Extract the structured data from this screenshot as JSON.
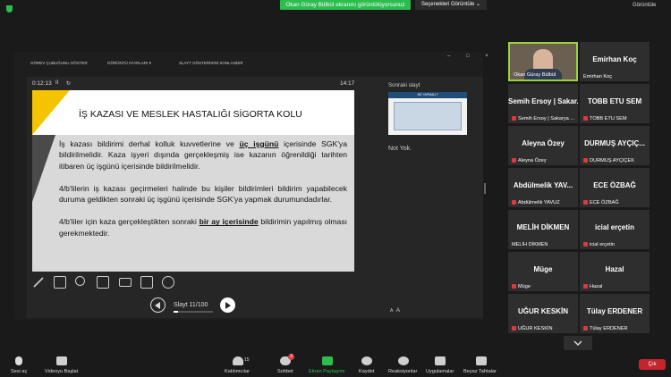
{
  "top": {
    "share_banner": "Okan Güray Bülbül ekranını görüntülüyorsunuz",
    "view_options": "Seçenekleri Görüntüle ⌄",
    "gallery_view": "Görüntüle"
  },
  "ppt_toolbar": {
    "taskbar": "GÖREV ÇUBUĞUNU GÖSTER",
    "display_settings": "GÖRÜNTÜ AYARLARI ▾",
    "end_show": "SLAYT GÖSTERİSİNİ SONLANDIR",
    "window_controls": "– □ ×"
  },
  "presenter": {
    "timer": "0:12:13",
    "pause": "II",
    "redo": "↻",
    "clock": "14:17",
    "next_slide_label": "Sonraki slayt",
    "next_thumb_title": "NE YAPMALI?",
    "notes": "Not Yok.",
    "zoom_small": "A",
    "zoom_big": "A",
    "slide_counter": "Slayt 11/100",
    "progress": 0.11
  },
  "slide": {
    "title": "İŞ KAZASI VE MESLEK HASTALIĞI SİGORTA KOLU",
    "p1_a": "İş kazası bildirimi derhal kolluk kuvvetlerine ve ",
    "p1_u": "üç işgünü",
    "p1_b": " içerisinde SGK'ya bildirilmelidir. Kaza işyeri dışında gerçekleşmiş ise kazanın öğrenildiği tarihten itibaren üç işgünü içerisinde bildirilmelidir.",
    "p2": "4/b'lilerin iş kazası geçirmeleri halinde bu kişiler bildirimleri bildirim yapabilecek duruma geldikten sonraki üç işgünü içerisinde SGK'ya yapmak durumundadırlar.",
    "p3_a": "4/b'liler için kaza gerçekleştikten sonraki ",
    "p3_u": "bir ay içerisinde",
    "p3_b": " bildirimin yapılmış olması gerekmektedir."
  },
  "participants": [
    {
      "name": "",
      "label": "Okan Güray Bülbül",
      "muted": false
    },
    {
      "name": "Emirhan Koç",
      "label": "Emirhan Koç",
      "muted": false
    },
    {
      "name": "Semih Ersoy | Sakar...",
      "label": "Semih Ersoy | Sakarya ...",
      "muted": true
    },
    {
      "name": "TOBB ETU SEM",
      "label": "TOBB ETU SEM",
      "muted": true
    },
    {
      "name": "Aleyna Özey",
      "label": "Aleyna Özey",
      "muted": true
    },
    {
      "name": "DURMUŞ AYÇIÇ...",
      "label": "DURMUŞ AYÇIÇEK",
      "muted": true
    },
    {
      "name": "Abdülmelik YAV...",
      "label": "Abdülmelik YAVUZ",
      "muted": true
    },
    {
      "name": "ECE ÖZBAĞ",
      "label": "ECE ÖZBAĞ",
      "muted": true
    },
    {
      "name": "MELİH DİKMEN",
      "label": "MELİH DİKMEN",
      "muted": false
    },
    {
      "name": "icial erçetin",
      "label": "icial erçetin",
      "muted": true
    },
    {
      "name": "Müge",
      "label": "Müge",
      "muted": true
    },
    {
      "name": "Hazal",
      "label": "Hazal",
      "muted": true
    },
    {
      "name": "UĞUR KESKİN",
      "label": "UĞUR KESKİN",
      "muted": true
    },
    {
      "name": "Tülay ERDENER",
      "label": "Tülay ERDENER",
      "muted": true
    }
  ],
  "bottom": {
    "mute": "Sesi aç",
    "video": "Videoyu Başlat",
    "participants": "Katılımcılar",
    "participants_count": "15",
    "chat": "Sohbet",
    "chat_badge": "3",
    "share": "Ekran Paylaşımı",
    "record": "Kaydet",
    "reactions": "Reaksiyonlar",
    "apps": "Uygulamalar",
    "whiteboard": "Beyaz Tahtalar",
    "leave": "Çık"
  },
  "colors": {
    "accent_green": "#2dbd4f",
    "slide_yellow": "#f5c400",
    "leave_red": "#c5242d"
  }
}
